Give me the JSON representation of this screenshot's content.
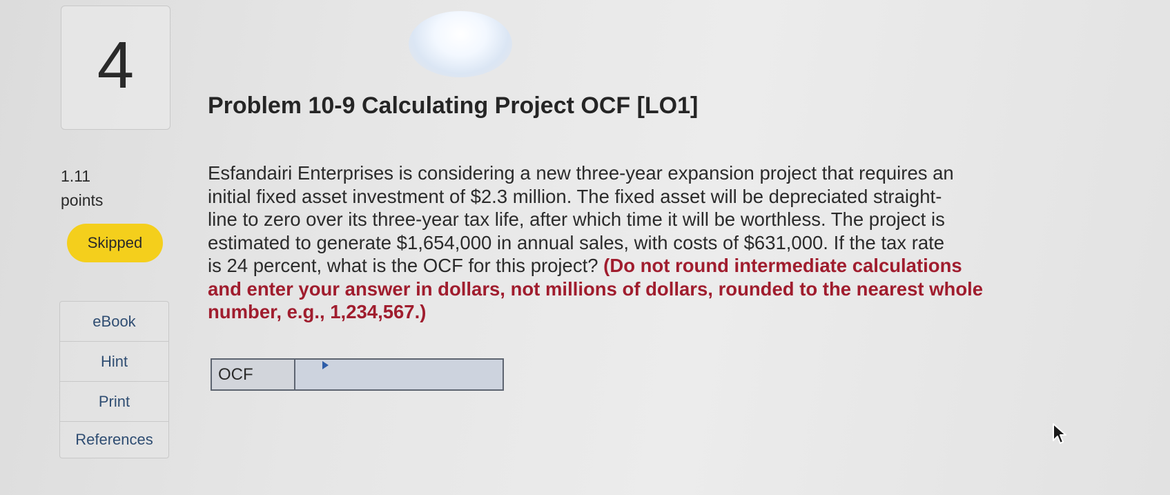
{
  "question": {
    "number": "4",
    "points_value": "1.11",
    "points_label": "points",
    "status": "Skipped"
  },
  "side_links": [
    "eBook",
    "Hint",
    "Print",
    "References"
  ],
  "problem": {
    "title": "Problem 10-9 Calculating Project OCF [LO1]",
    "text_lines": [
      "Esfandairi Enterprises is considering a new three-year expansion project that requires an",
      "initial fixed asset investment of $2.3 million. The fixed asset will be depreciated straight-",
      "line to zero over its three-year tax life, after which time it will be worthless. The project is",
      "estimated to generate $1,654,000 in annual sales, with costs of $631,000. If the tax rate",
      "is 24 percent, what is the OCF for this project?"
    ],
    "instruction_lines": [
      "(Do not round intermediate calculations",
      "and enter your answer in dollars, not millions of dollars, rounded to the nearest whole",
      "number, e.g., 1,234,567.)"
    ]
  },
  "answer": {
    "label": "OCF",
    "value": ""
  },
  "colors": {
    "status_badge": "#f4cf1c",
    "instruction_text": "#a01d2e",
    "link_text": "#2f4d72"
  }
}
